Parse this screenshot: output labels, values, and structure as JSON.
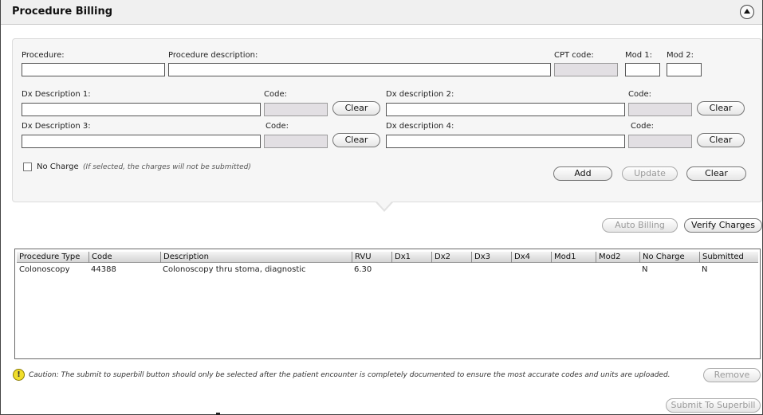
{
  "header": {
    "title": "Procedure Billing",
    "collapse_icon": "chevron-up-icon"
  },
  "form": {
    "procedure_label": "Procedure:",
    "procedure_value": "",
    "procedure_description_label": "Procedure description:",
    "procedure_description_value": "",
    "cpt_code_label": "CPT code:",
    "cpt_code_value": "",
    "mod1_label": "Mod 1:",
    "mod1_value": "",
    "mod2_label": "Mod 2:",
    "mod2_value": "",
    "dx1_label": "Dx Description 1:",
    "dx1_code_label": "Code:",
    "dx2_label": "Dx description 2:",
    "dx2_code_label": "Code:",
    "dx3_label": "Dx Description 3:",
    "dx3_code_label": "Code:",
    "dx4_label": "Dx description 4:",
    "dx4_code_label": "Code:",
    "clear_label": "Clear",
    "no_charge_label": "No Charge",
    "no_charge_hint": "(If selected, the charges will not be submitted)",
    "no_charge_checked": false,
    "add_label": "Add",
    "update_label": "Update",
    "clear_form_label": "Clear"
  },
  "actions": {
    "auto_billing_label": "Auto Billing",
    "verify_charges_label": "Verify Charges"
  },
  "table": {
    "columns": [
      "Procedure Type",
      "Code",
      "Description",
      "RVU",
      "Dx1",
      "Dx2",
      "Dx3",
      "Dx4",
      "Mod1",
      "Mod2",
      "No Charge",
      "Submitted"
    ],
    "rows": [
      [
        "Colonoscopy",
        "44388",
        "Colonoscopy thru stoma, diagnostic",
        "6.30",
        "",
        "",
        "",
        "",
        "",
        "",
        "N",
        "N"
      ]
    ]
  },
  "footer": {
    "caution_icon": "warning-icon",
    "caution_text": "Caution: The submit to superbill button should only be selected after the patient encounter is completely documented to ensure the most accurate codes and units are uploaded.",
    "remove_label": "Remove",
    "submit_label": "Submit To Superbill"
  },
  "colors": {
    "readonly_field": "#e2dfe3",
    "caution_icon": "#f1de2b",
    "header_bg": "#f0f0f0"
  }
}
